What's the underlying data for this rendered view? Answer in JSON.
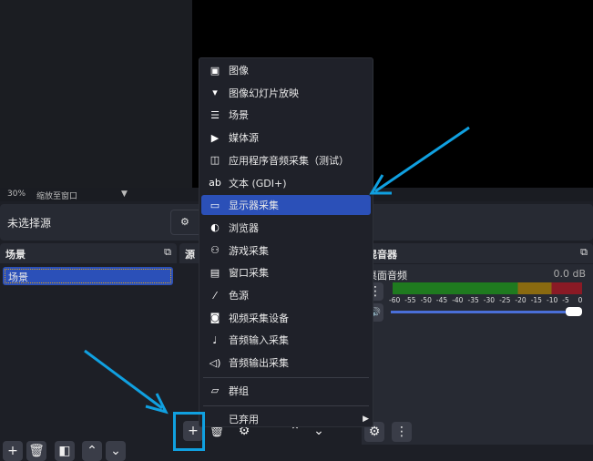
{
  "status": {
    "zoom": "30%",
    "scale_mode": "缩放至窗口"
  },
  "properties": {
    "no_source": "未选择源"
  },
  "scenes": {
    "title": "场景",
    "items": [
      "场景"
    ]
  },
  "sources": {
    "title": "源"
  },
  "mixer": {
    "title": "混音器",
    "channel": "桌面音频",
    "level": "0.0 dB",
    "ticks": [
      "-60",
      "-55",
      "-50",
      "-45",
      "-40",
      "-35",
      "-30",
      "-25",
      "-20",
      "-15",
      "-10",
      "-5",
      "0"
    ],
    "volume_percent": 100
  },
  "menu": {
    "items": [
      {
        "icon": "image-icon",
        "label": "图像"
      },
      {
        "icon": "slideshow-icon",
        "label": "图像幻灯片放映"
      },
      {
        "icon": "list-icon",
        "label": "场景"
      },
      {
        "icon": "play-icon",
        "label": "媒体源"
      },
      {
        "icon": "app-audio-icon",
        "label": "应用程序音频采集（测试）"
      },
      {
        "icon": "text-icon",
        "label": "文本 (GDI+)"
      },
      {
        "icon": "monitor-icon",
        "label": "显示器采集",
        "selected": true
      },
      {
        "icon": "globe-icon",
        "label": "浏览器"
      },
      {
        "icon": "gamepad-icon",
        "label": "游戏采集"
      },
      {
        "icon": "window-icon",
        "label": "窗口采集"
      },
      {
        "icon": "brush-icon",
        "label": "色源"
      },
      {
        "icon": "camera-icon",
        "label": "视频采集设备"
      },
      {
        "icon": "microphone-icon",
        "label": "音频输入采集"
      },
      {
        "icon": "speaker-icon",
        "label": "音频输出采集"
      },
      {
        "icon": "folder-icon",
        "label": "群组"
      },
      {
        "icon": "",
        "label": "已弃用",
        "submenu": true
      }
    ]
  },
  "colors": {
    "accent": "#2b50b8",
    "annotation": "#10a0e0"
  }
}
